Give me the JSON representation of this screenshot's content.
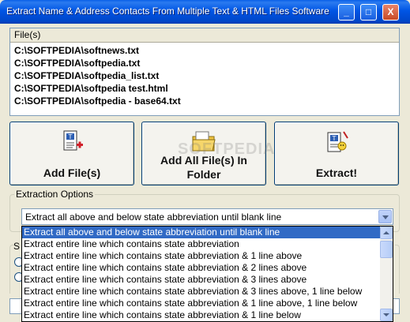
{
  "window": {
    "title": "Extract Name & Address Contacts From Multiple Text & HTML Files Software",
    "controls": [
      "_",
      "□",
      "X"
    ]
  },
  "files": {
    "header": "File(s)",
    "items": [
      "C:\\SOFTPEDIA\\softnews.txt",
      "C:\\SOFTPEDIA\\softpedia.txt",
      "C:\\SOFTPEDIA\\softpedia_list.txt",
      "C:\\SOFTPEDIA\\softpedia test.html",
      "C:\\SOFTPEDIA\\softpedia - base64.txt"
    ]
  },
  "buttons": {
    "add_files": "Add File(s)",
    "add_folder": "Add All File(s) In Folder",
    "extract": "Extract!"
  },
  "options": {
    "group_title": "Extraction Options",
    "selected": "Extract all above and below state abbreviation until blank line",
    "dropdown_items": [
      "Extract all above and below state abbreviation until blank line",
      "Extract entire line which contains state abbreviation",
      "Extract entire line which contains state abbreviation & 1 line above",
      "Extract entire line which contains state abbreviation & 2 lines above",
      "Extract entire line which contains state abbreviation & 3 lines above",
      "Extract entire line which contains state abbreviation & 3 lines above, 1 line below",
      "Extract entire line which contains state abbreviation & 1 line above, 1 line below",
      "Extract entire line which contains state abbreviation & 1 line below"
    ],
    "partial_label": "S"
  },
  "watermark": "SOFTPEDIA"
}
